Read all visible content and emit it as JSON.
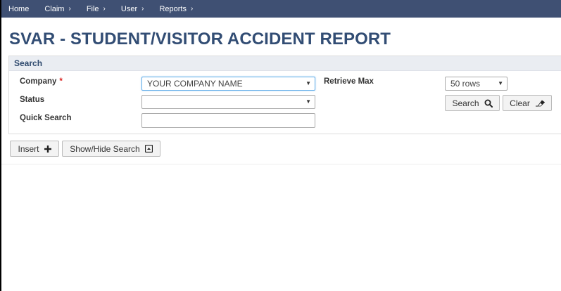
{
  "nav": {
    "items": [
      {
        "label": "Home",
        "has_chevron": false
      },
      {
        "label": "Claim",
        "has_chevron": true
      },
      {
        "label": "File",
        "has_chevron": true
      },
      {
        "label": "User",
        "has_chevron": true
      },
      {
        "label": "Reports",
        "has_chevron": true
      }
    ],
    "chevron": "›",
    "background": "#3f5073"
  },
  "page": {
    "title": "SVAR - STUDENT/VISITOR ACCIDENT REPORT",
    "title_color": "#324d74"
  },
  "search": {
    "header": "Search",
    "company_label": "Company",
    "required_mark": "*",
    "company_value": "YOUR COMPANY NAME",
    "status_label": "Status",
    "status_value": "",
    "quick_search_label": "Quick Search",
    "quick_search_value": "",
    "retrieve_max_label": "Retrieve Max",
    "retrieve_max_value": "50 rows",
    "search_button": "Search",
    "clear_button": "Clear"
  },
  "toolbar": {
    "insert_button": "Insert",
    "show_hide_button": "Show/Hide Search"
  },
  "icons": {
    "dropdown_arrow": "▼",
    "search": "search-icon",
    "eraser": "eraser-icon",
    "plus": "plus-icon",
    "collapse": "collapse-icon"
  }
}
